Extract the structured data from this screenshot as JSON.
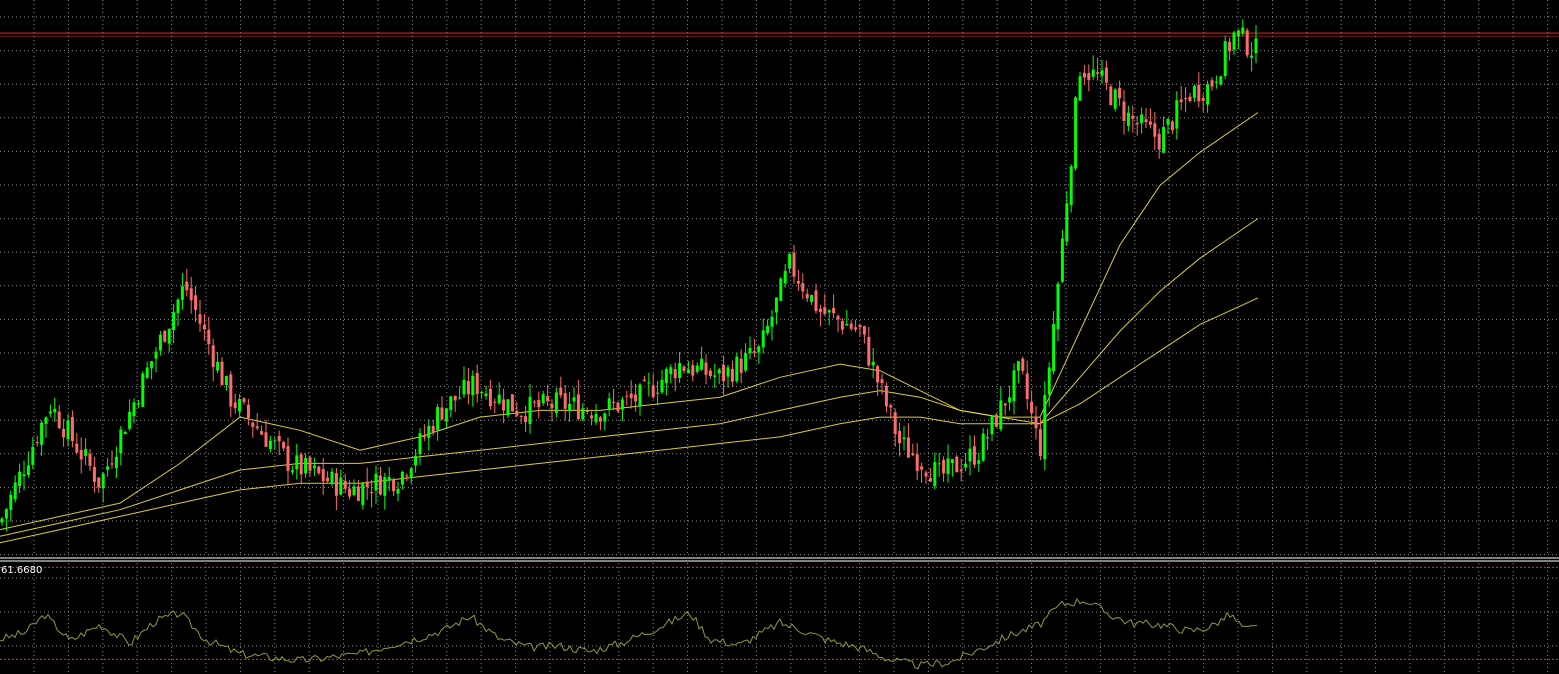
{
  "window": {
    "indicator_readout": "61.6680"
  },
  "colors": {
    "background": "#000000",
    "grid": "#9aa2a6",
    "bull_candle": "#00ff00",
    "bear_candle": "#ff6b6b",
    "moving_average": "#f2e040",
    "indicator_line": "#8c9a3a",
    "level_line": "#ff2020",
    "separator": "#ffffff"
  },
  "chart_data": [
    {
      "type": "candlestick",
      "title": "",
      "xlabel": "",
      "ylabel": "",
      "ylim": [
        0,
        100
      ],
      "grid": true,
      "moving_average_count": 3,
      "horizontal_levels": [
        {
          "value": 95.0,
          "style": "solid"
        },
        {
          "value": 14.3,
          "style": "dotted"
        }
      ],
      "price_anchors": {
        "x": [
          0,
          50,
          100,
          150,
          185,
          230,
          290,
          350,
          400,
          440,
          475,
          520,
          560,
          600,
          640,
          680,
          720,
          760,
          790,
          820,
          860,
          900,
          940,
          980,
          1020,
          1040,
          1060,
          1080,
          1100,
          1130,
          1160,
          1190,
          1210,
          1235,
          1258
        ],
        "close": [
          21,
          39,
          27,
          45,
          57,
          40,
          30,
          26,
          28,
          38,
          42,
          38,
          39,
          38,
          40,
          45,
          43,
          47,
          60,
          53,
          50,
          33,
          28,
          32,
          44,
          32,
          60,
          90,
          88,
          82,
          79,
          86,
          87,
          95,
          92
        ]
      },
      "moving_averages": [
        {
          "x": [
            0,
            60,
            120,
            180,
            240,
            300,
            360,
            420,
            480,
            540,
            600,
            660,
            720,
            780,
            840,
            880,
            920,
            960,
            1000,
            1040,
            1080,
            1120,
            1160,
            1200,
            1258
          ],
          "values": [
            20,
            22,
            24,
            30,
            37,
            35,
            32,
            34,
            37,
            38,
            38,
            39,
            40,
            43,
            45,
            44,
            41,
            38,
            37,
            37,
            50,
            63,
            72,
            77,
            83
          ]
        },
        {
          "x": [
            0,
            60,
            120,
            180,
            240,
            300,
            360,
            420,
            480,
            540,
            600,
            660,
            720,
            780,
            840,
            880,
            920,
            960,
            1000,
            1040,
            1080,
            1120,
            1160,
            1200,
            1258
          ],
          "values": [
            19,
            21,
            23,
            26,
            29,
            30,
            30,
            31,
            32,
            33,
            34,
            35,
            36,
            38,
            40,
            41,
            40,
            38,
            37,
            36,
            43,
            50,
            56,
            61,
            67
          ]
        },
        {
          "x": [
            0,
            60,
            120,
            180,
            240,
            300,
            360,
            420,
            480,
            540,
            600,
            660,
            720,
            780,
            840,
            880,
            920,
            960,
            1000,
            1040,
            1080,
            1120,
            1160,
            1200,
            1258
          ],
          "values": [
            18,
            20,
            22,
            24,
            26,
            27,
            27,
            28,
            29,
            30,
            31,
            32,
            33,
            34,
            36,
            37,
            37,
            36,
            36,
            36,
            39,
            43,
            47,
            51,
            55
          ]
        }
      ]
    },
    {
      "type": "line",
      "title": "",
      "xlabel": "",
      "ylabel": "",
      "ylim": [
        0,
        100
      ],
      "grid": true,
      "horizontal_levels": [
        {
          "value": 30.0,
          "style": "dotted"
        }
      ],
      "series": [
        {
          "x": [
            0,
            25,
            45,
            70,
            100,
            130,
            155,
            180,
            205,
            240,
            270,
            300,
            330,
            360,
            390,
            420,
            445,
            470,
            500,
            530,
            560,
            590,
            620,
            650,
            690,
            710,
            740,
            780,
            800,
            830,
            860,
            890,
            920,
            950,
            980,
            1010,
            1040,
            1060,
            1085,
            1110,
            1130,
            1160,
            1190,
            1210,
            1230,
            1245,
            1258
          ],
          "values": [
            40,
            48,
            70,
            38,
            58,
            35,
            62,
            72,
            40,
            22,
            18,
            14,
            18,
            22,
            33,
            42,
            52,
            68,
            40,
            30,
            32,
            25,
            35,
            50,
            72,
            40,
            33,
            60,
            52,
            38,
            30,
            15,
            8,
            12,
            28,
            45,
            58,
            82,
            88,
            70,
            60,
            58,
            50,
            55,
            70,
            52,
            55
          ]
        }
      ]
    }
  ]
}
